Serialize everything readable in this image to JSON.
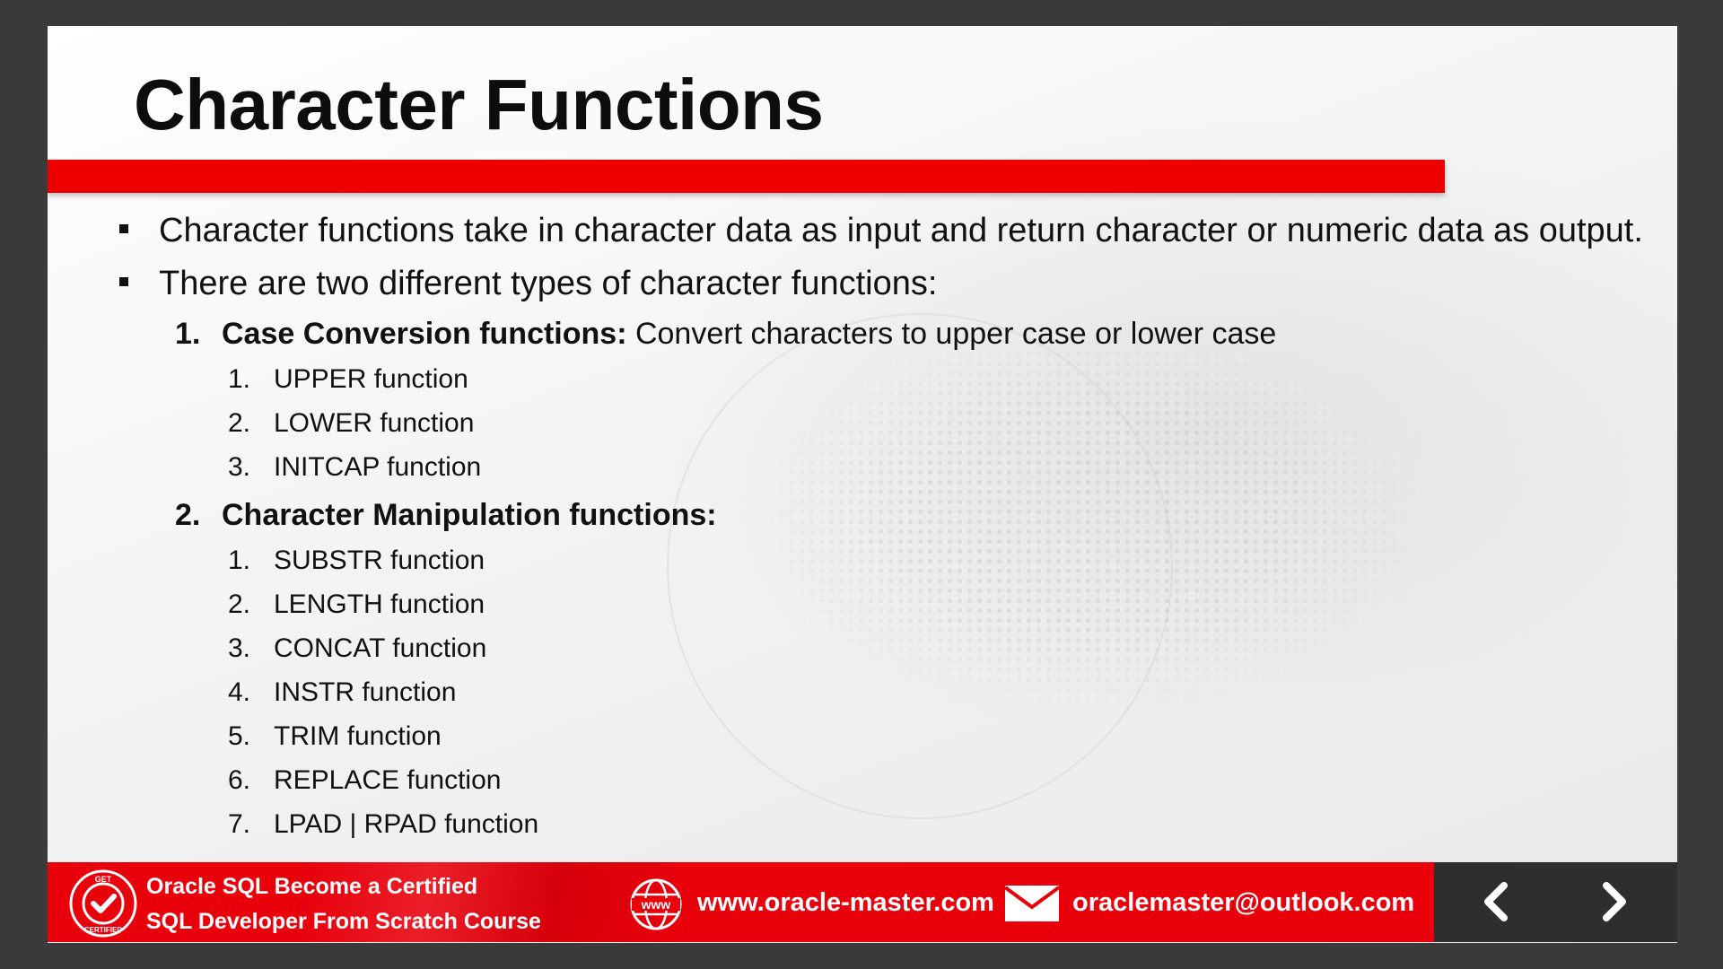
{
  "slide": {
    "title": "Character Functions",
    "bullets": [
      "Character functions take in character data as input and return character or numeric data as output.",
      "There are two different types of character functions:"
    ],
    "groups": [
      {
        "number": "1.",
        "heading": "Case Conversion functions:",
        "description": " Convert characters to upper case or lower case",
        "items": [
          {
            "number": "1.",
            "label": "UPPER function"
          },
          {
            "number": "2.",
            "label": "LOWER function"
          },
          {
            "number": "3.",
            "label": "INITCAP function"
          }
        ]
      },
      {
        "number": "2.",
        "heading": "Character Manipulation functions:",
        "description": "",
        "items": [
          {
            "number": "1.",
            "label": "SUBSTR function"
          },
          {
            "number": "2.",
            "label": "LENGTH function"
          },
          {
            "number": "3.",
            "label": "CONCAT function"
          },
          {
            "number": "4.",
            "label": "INSTR function"
          },
          {
            "number": "5.",
            "label": "TRIM function"
          },
          {
            "number": "6.",
            "label": "REPLACE function"
          },
          {
            "number": "7.",
            "label": "LPAD | RPAD function"
          }
        ]
      }
    ]
  },
  "footer": {
    "course_line1": "Oracle SQL Become a Certified",
    "course_line2": "SQL  Developer  From Scratch Course",
    "badge_top": "GET",
    "badge_bottom": "CERTIFIED",
    "website_icon_text": "www",
    "website": "www.oracle-master.com",
    "email": "oraclemaster@outlook.com"
  },
  "colors": {
    "accent_red": "#ee0000",
    "footer_red": "#e8000b",
    "footer_dark": "#2e2e2e",
    "text": "#111111"
  },
  "icons": {
    "certified_badge": "certified-badge-icon",
    "website": "globe-www-icon",
    "email": "envelope-icon",
    "previous": "chevron-left-icon",
    "next": "chevron-right-icon"
  }
}
